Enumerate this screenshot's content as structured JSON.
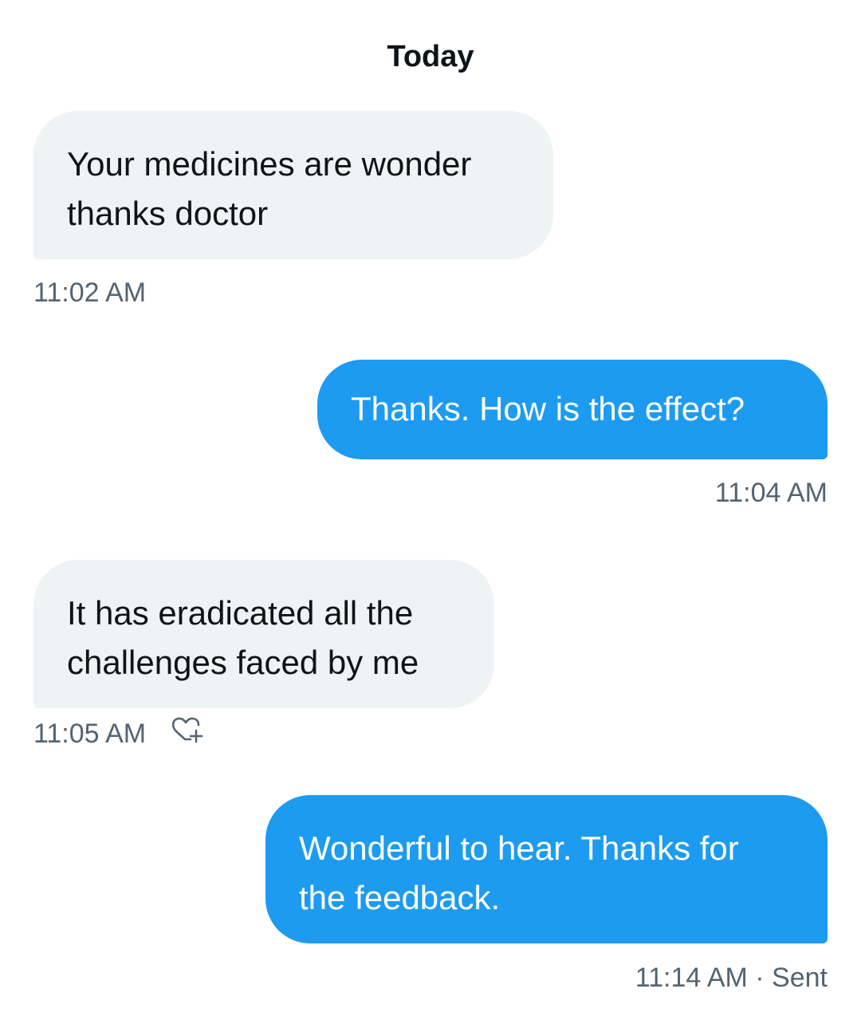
{
  "conversation": {
    "date_divider": "Today",
    "messages": [
      {
        "direction": "received",
        "text": "Your medicines are wonder thanks doctor",
        "time": "11:02 AM"
      },
      {
        "direction": "sent",
        "text": "Thanks. How is the effect?",
        "time": "11:04 AM"
      },
      {
        "direction": "received",
        "text": "It has eradicated all the challenges faced by me",
        "time": "11:05 AM",
        "reaction_icon": "heart-plus-icon"
      },
      {
        "direction": "sent",
        "text": "Wonderful to hear. Thanks for the feedback.",
        "time": "11:14 AM · Sent"
      }
    ]
  },
  "colors": {
    "sent_bubble": "#1d9bf0",
    "received_bubble": "#eff3f4",
    "timestamp": "#536471"
  }
}
